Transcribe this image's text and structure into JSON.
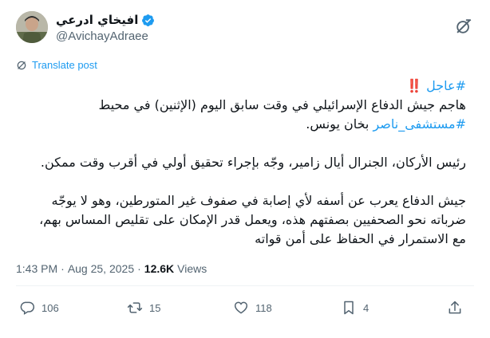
{
  "author": {
    "display_name": "افيخاي ادرعي",
    "handle": "@AvichayAdraee"
  },
  "translate_label": "Translate post",
  "body": {
    "alert_hashtag": "#عاجل",
    "alert_marks": "‼️",
    "line1": "هاجم جيش الدفاع الإسرائيلي في وقت سابق اليوم (الإثنين) في محيط",
    "hashtag2": "#مستشفى_ناصر",
    "line2_rest": " بخان يونس.",
    "para2": "رئيس الأركان، الجنرال أيال زامير، وجّه بإجراء تحقيق أولي في أقرب وقت ممكن.",
    "para3_line1": "جيش الدفاع يعرب عن أسفه لأي إصابة في صفوف غير المتورطين، وهو لا يوجّه",
    "para3_line2": "ضرباته نحو الصحفيين بصفتهم هذه، ويعمل قدر الإمكان على تقليص المساس بهم،",
    "para3_line3": "مع الاستمرار في الحفاظ على أمن قواته"
  },
  "meta": {
    "time": "1:43 PM",
    "separator": "·",
    "date": "Aug 25, 2025",
    "separator2": "·",
    "views_count": "12.6K",
    "views_label": "Views"
  },
  "actions": {
    "replies": "106",
    "reposts": "15",
    "likes": "118",
    "bookmarks": "4"
  },
  "colors": {
    "accent": "#1d9bf0",
    "text": "#0f1419",
    "muted": "#536471",
    "alert": "#e0245e"
  }
}
